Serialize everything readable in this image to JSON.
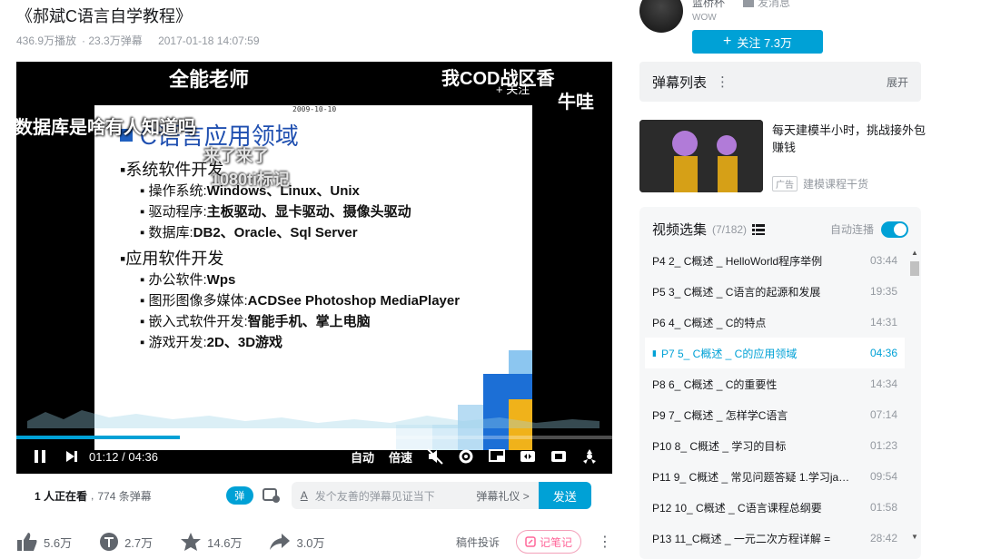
{
  "video": {
    "title": "《郝斌C语言自学教程》",
    "views": "436.9万播放",
    "danmaku_count": "23.3万弹幕",
    "date": "2017-01-18 14:07:59"
  },
  "player": {
    "slide_date": "2009-10-10",
    "slide_title": "C语言应用领域",
    "sections": [
      {
        "heading": "系统软件开发",
        "items": [
          {
            "label": "操作系统:",
            "value": "Windows、Linux、Unix"
          },
          {
            "label": "驱动程序:",
            "value": "主板驱动、显卡驱动、摄像头驱动"
          },
          {
            "label": "数据库:",
            "value": "DB2、Oracle、Sql Server"
          }
        ]
      },
      {
        "heading": "应用软件开发",
        "items": [
          {
            "label": "办公软件:",
            "value": "Wps"
          },
          {
            "label": "图形图像多媒体:",
            "value": "ACDSee Photoshop MediaPlayer"
          },
          {
            "label": "嵌入式软件开发:",
            "value": "智能手机、掌上电脑"
          },
          {
            "label": "游戏开发:",
            "value": "2D、3D游戏"
          }
        ]
      }
    ],
    "danmaku": [
      "全能老师",
      "我COD战区香",
      "牛哇",
      "数据库是啥有人知道吗",
      "来了来了",
      "1080ti标记"
    ],
    "follow_overlay": "+ 关注",
    "time_current": "01:12",
    "time_total": "04:36",
    "progress": 0.275,
    "auto_label": "自动",
    "speed_label": "倍速"
  },
  "viewer_bar": {
    "watching": "1 人正在看",
    "danmaku": "774 条弹幕",
    "switch_label": "弹",
    "input_placeholder": "发个友善的弹幕见证当下",
    "etiquette": "弹幕礼仪 >",
    "send": "发送"
  },
  "actions": {
    "like": "5.6万",
    "coin": "2.7万",
    "fav": "14.6万",
    "share": "3.0万",
    "report": "稿件投诉",
    "note": "记笔记"
  },
  "uploader": {
    "name": "蓝桥杯",
    "sub": "WOW",
    "charge": "发消息",
    "follow": "关注 7.3万"
  },
  "danmaku_list": {
    "title": "弹幕列表",
    "expand": "展开"
  },
  "ad": {
    "text": "每天建模半小时，挑战接外包赚钱",
    "tag": "广告",
    "source": "建模课程干货"
  },
  "playlist": {
    "title": "视频选集",
    "count": "(7/182)",
    "autoplay": "自动连播",
    "items": [
      {
        "label": "P4  2_ C概述 _ HelloWorld程序举例",
        "dur": "03:44",
        "active": false
      },
      {
        "label": "P5  3_ C概述 _ C语言的起源和发展",
        "dur": "19:35",
        "active": false
      },
      {
        "label": "P6  4_ C概述 _ C的特点",
        "dur": "14:31",
        "active": false
      },
      {
        "label": "P7  5_ C概述 _ C的应用领域",
        "dur": "04:36",
        "active": true
      },
      {
        "label": "P8  6_ C概述 _ C的重要性",
        "dur": "14:34",
        "active": false
      },
      {
        "label": "P9  7_ C概述 _ 怎样学C语言",
        "dur": "07:14",
        "active": false
      },
      {
        "label": "P10  8_ C概述 _ 学习的目标",
        "dur": "01:23",
        "active": false
      },
      {
        "label": "P11  9_ C概述 _ 常见问题答疑 1.学习java...",
        "dur": "09:54",
        "active": false
      },
      {
        "label": "P12  10_ C概述 _ C语言课程总纲要",
        "dur": "01:58",
        "active": false
      },
      {
        "label": "P13  11_C概述 _ 一元二次方程详解 =",
        "dur": "28:42",
        "active": false
      }
    ]
  }
}
